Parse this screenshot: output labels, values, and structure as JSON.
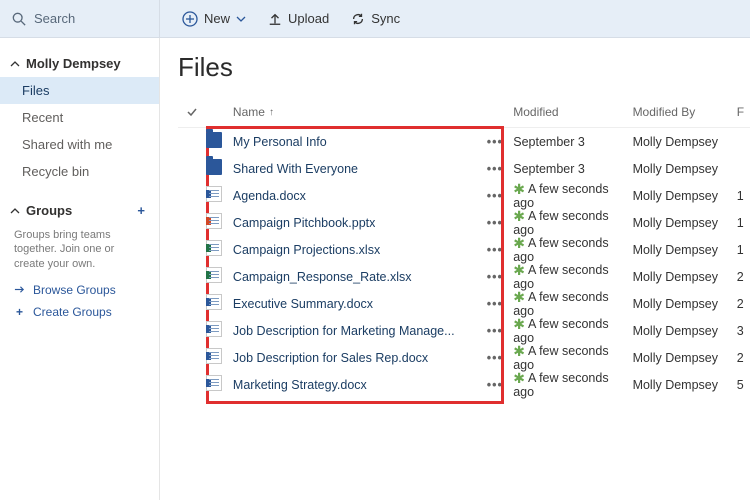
{
  "topbar": {
    "search_placeholder": "Search",
    "new_label": "New",
    "upload_label": "Upload",
    "sync_label": "Sync"
  },
  "sidebar": {
    "user_name": "Molly Dempsey",
    "nav": [
      {
        "label": "Files",
        "active": true
      },
      {
        "label": "Recent",
        "active": false
      },
      {
        "label": "Shared with me",
        "active": false
      },
      {
        "label": "Recycle bin",
        "active": false
      }
    ],
    "groups_header": "Groups",
    "groups_note": "Groups bring teams together. Join one or create your own.",
    "browse_groups": "Browse Groups",
    "create_groups": "Create Groups"
  },
  "page": {
    "title": "Files",
    "columns": {
      "name": "Name",
      "modified": "Modified",
      "modified_by": "Modified By",
      "tail": "F"
    }
  },
  "files": [
    {
      "icon": "folder",
      "name": "My Personal Info",
      "new": false,
      "modified": "September 3",
      "modified_by": "Molly Dempsey",
      "tail": ""
    },
    {
      "icon": "folder",
      "name": "Shared With Everyone",
      "new": false,
      "modified": "September 3",
      "modified_by": "Molly Dempsey",
      "tail": ""
    },
    {
      "icon": "word",
      "name": "Agenda.docx",
      "new": true,
      "modified": "A few seconds ago",
      "modified_by": "Molly Dempsey",
      "tail": "1"
    },
    {
      "icon": "ppt",
      "name": "Campaign Pitchbook.pptx",
      "new": true,
      "modified": "A few seconds ago",
      "modified_by": "Molly Dempsey",
      "tail": "1"
    },
    {
      "icon": "xls",
      "name": "Campaign Projections.xlsx",
      "new": true,
      "modified": "A few seconds ago",
      "modified_by": "Molly Dempsey",
      "tail": "1"
    },
    {
      "icon": "xls",
      "name": "Campaign_Response_Rate.xlsx",
      "new": true,
      "modified": "A few seconds ago",
      "modified_by": "Molly Dempsey",
      "tail": "2"
    },
    {
      "icon": "word",
      "name": "Executive Summary.docx",
      "new": true,
      "modified": "A few seconds ago",
      "modified_by": "Molly Dempsey",
      "tail": "2"
    },
    {
      "icon": "word",
      "name": "Job Description for Marketing Manage...",
      "new": true,
      "modified": "A few seconds ago",
      "modified_by": "Molly Dempsey",
      "tail": "3"
    },
    {
      "icon": "word",
      "name": "Job Description for Sales Rep.docx",
      "new": true,
      "modified": "A few seconds ago",
      "modified_by": "Molly Dempsey",
      "tail": "2"
    },
    {
      "icon": "word",
      "name": "Marketing Strategy.docx",
      "new": true,
      "modified": "A few seconds ago",
      "modified_by": "Molly Dempsey",
      "tail": "5"
    }
  ]
}
